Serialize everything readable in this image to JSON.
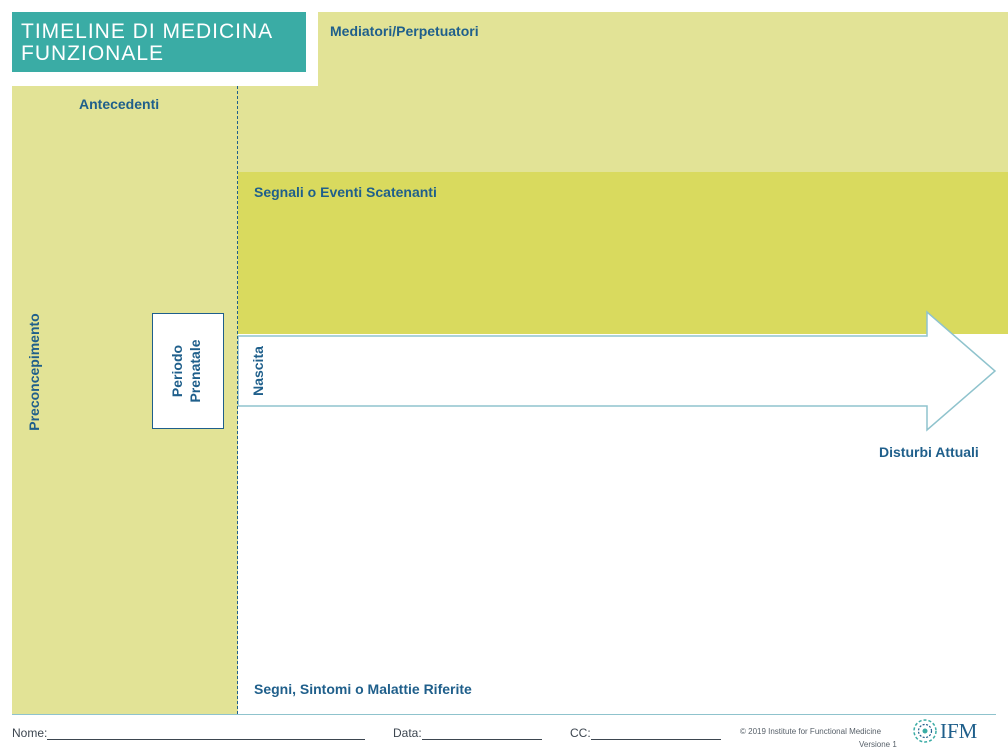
{
  "title": {
    "line1": "TIMELINE DI MEDICINA",
    "line2": "FUNZIONALE"
  },
  "sections": {
    "mediators": "Mediatori/Perpetuatori",
    "antecedents": "Antecedenti",
    "triggers": "Segnali o Eventi Scatenanti",
    "signs": "Segni, Sintomi o Malattie Riferite",
    "current": "Disturbi Attuali"
  },
  "timeline": {
    "preconception": "Preconcepimento",
    "prenatal_line1": "Periodo",
    "prenatal_line2": "Prenatale",
    "birth": "Nascita"
  },
  "footer": {
    "name_label": "Nome:",
    "date_label": "Data:",
    "cc_label": "CC:",
    "copyright": "© 2019 Institute for Functional Medicine",
    "version": "Versione 1",
    "logo_text": "IFM"
  },
  "colors": {
    "teal": "#3aaca5",
    "light_olive": "#e2e396",
    "olive": "#d9da5e",
    "label_blue": "#1f5f8b"
  }
}
